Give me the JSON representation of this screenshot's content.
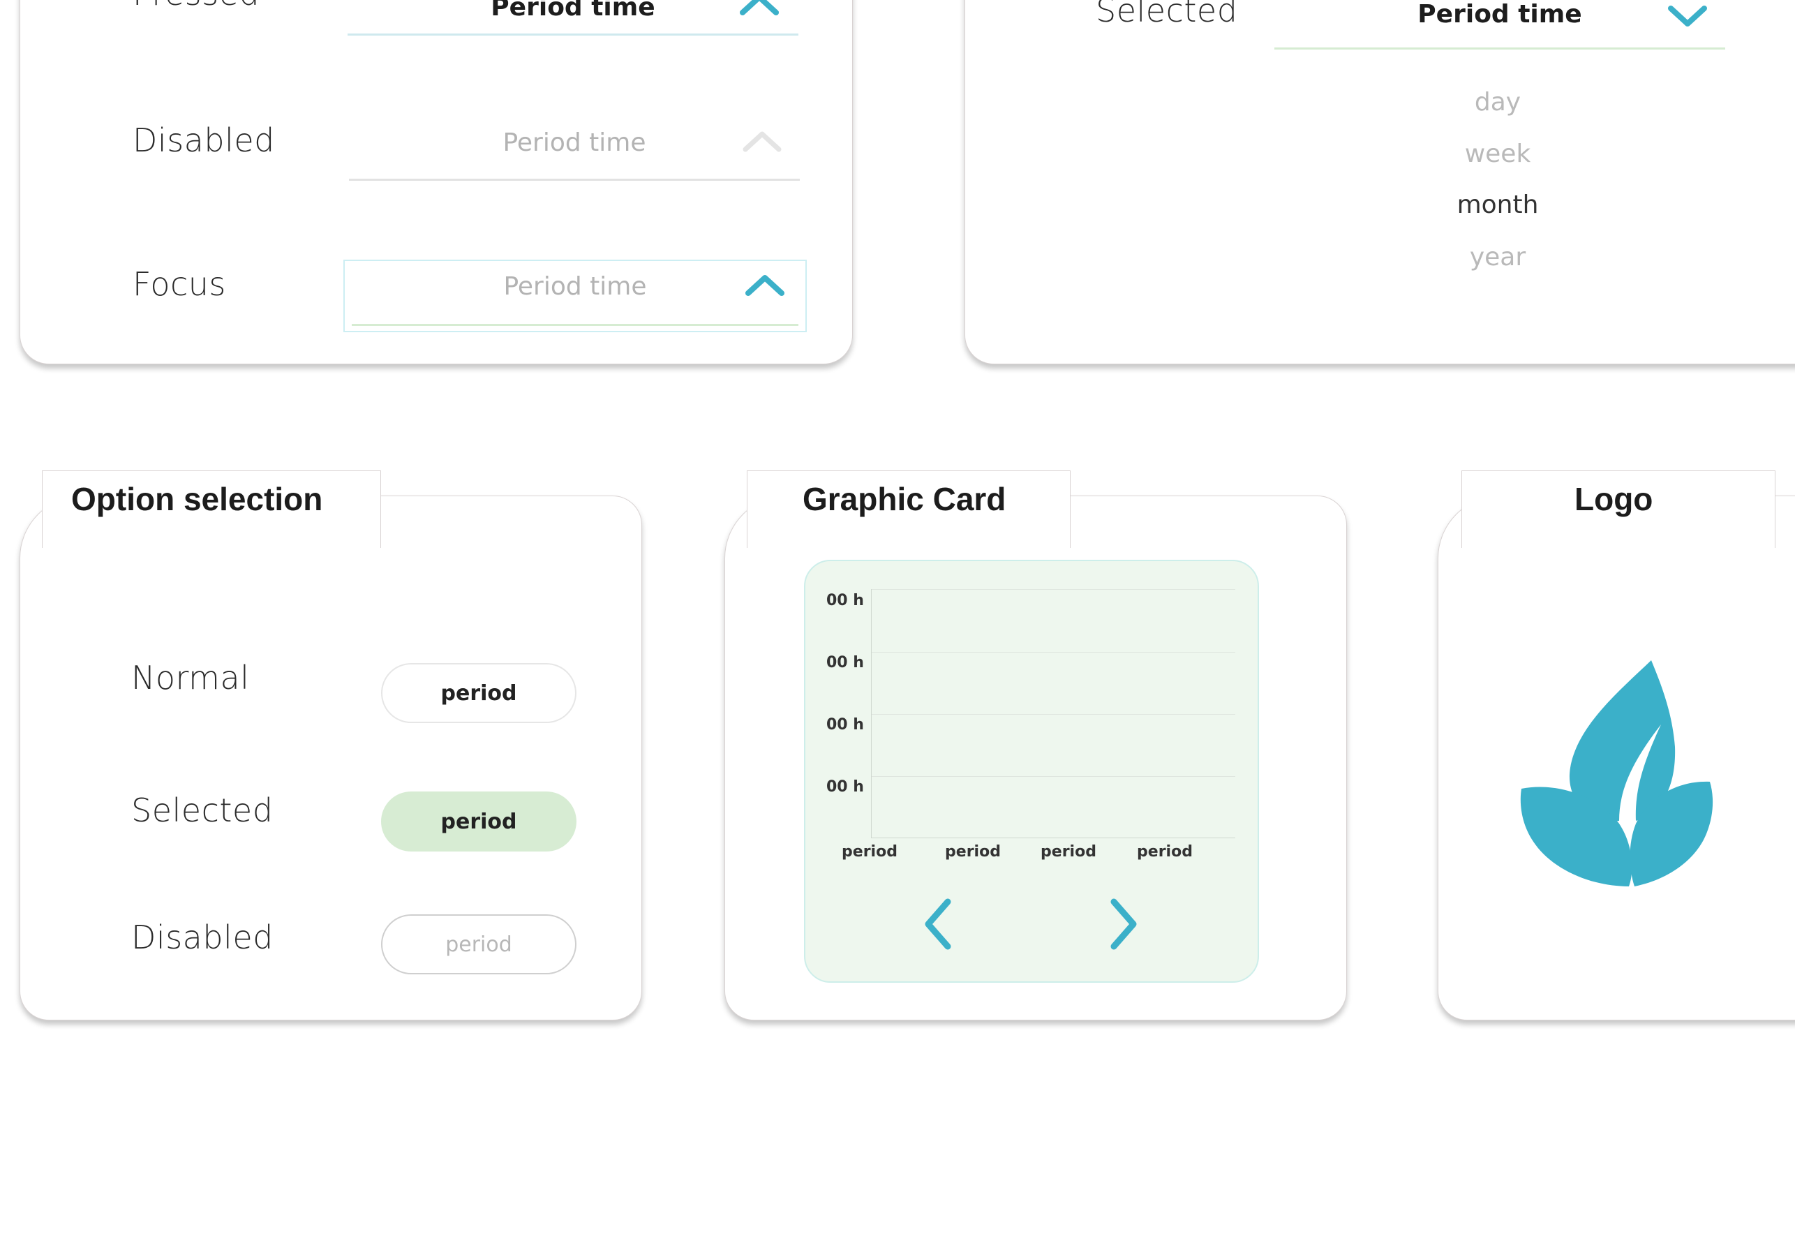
{
  "colors": {
    "accent_teal": "#3bb0c9",
    "selected_green": "#d7ecd3",
    "graph_bg": "#eef7ee",
    "disabled_text": "#b9b9b9"
  },
  "dropdown_states_card": {
    "pressed": {
      "label": "Pressed",
      "value": "Period time",
      "icon": "chevron-up-icon"
    },
    "disabled": {
      "label": "Disabled",
      "value": "Period time",
      "icon": "chevron-up-icon"
    },
    "focus": {
      "label": "Focus",
      "value": "Period time",
      "icon": "chevron-up-icon"
    }
  },
  "dropdown_open_card": {
    "label": "Selected",
    "value": "Period time",
    "icon": "chevron-down-icon",
    "options": [
      "day",
      "week",
      "month",
      "year"
    ],
    "selected_option": "month"
  },
  "option_selection": {
    "title": "Option selection",
    "rows": [
      {
        "label": "Normal",
        "button": "period",
        "state": "normal"
      },
      {
        "label": "Selected",
        "button": "period",
        "state": "selected"
      },
      {
        "label": "Disabled",
        "button": "period",
        "state": "disabled"
      }
    ]
  },
  "graphic_card": {
    "title": "Graphic Card",
    "prev_icon": "chevron-left-icon",
    "next_icon": "chevron-right-icon"
  },
  "chart_data": {
    "type": "bar",
    "title": "",
    "xlabel": "",
    "ylabel": "",
    "y_tick_labels": [
      "00 h",
      "00 h",
      "00 h",
      "00 h"
    ],
    "categories": [
      "period",
      "period",
      "period",
      "period"
    ],
    "values": [],
    "grid": true
  },
  "logo_card": {
    "title": "Logo",
    "icon": "leaf-logo-icon"
  }
}
